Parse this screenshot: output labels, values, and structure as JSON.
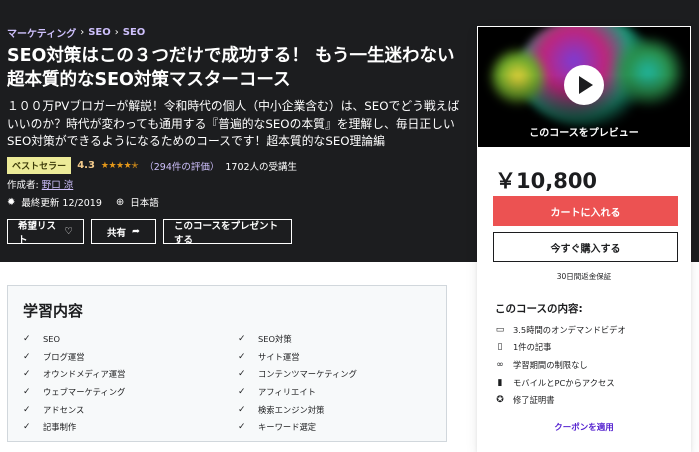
{
  "breadcrumb": {
    "items": [
      "マーケティング",
      "SEO",
      "SEO"
    ],
    "separator": "›"
  },
  "course": {
    "title": "SEO対策はこの３つだけで成功する！ もう一生迷わない超本質的なSEO対策マスターコース",
    "subtitle": "１００万PVブロガーが解説！令和時代の個人（中小企業含む）は、SEOでどう戦えばいいのか？時代が変わっても通用する『普遍的なSEOの本質』を理解し、毎日正しいSEO対策ができるようになるためのコースです！超本質的なSEO理論編",
    "badge": "ベストセラー",
    "rating": "4.3",
    "stars": "★★★★✭",
    "reviews": "（294件の評価）",
    "students": "1702人の受講生",
    "author_prefix": "作成者:",
    "author": "野口 涼",
    "last_updated": "最終更新 12/2019",
    "language": "日本語"
  },
  "actions": {
    "wishlist": "希望リスト",
    "share": "共有",
    "gift": "このコースをプレゼントする"
  },
  "sidebar": {
    "preview_label": "このコースをプレビュー",
    "price": "￥10,800",
    "cart_button": "カートに入れる",
    "buy_button": "今すぐ購入する",
    "guarantee": "30日間返金保証",
    "includes_title": "このコースの内容:",
    "includes": [
      {
        "icon": "video-icon",
        "glyph": "▭",
        "label": "3.5時間のオンデマンドビデオ"
      },
      {
        "icon": "file-icon",
        "glyph": "▯",
        "label": "1件の記事"
      },
      {
        "icon": "infinity-icon",
        "glyph": "∞",
        "label": "学習期間の制限なし"
      },
      {
        "icon": "mobile-icon",
        "glyph": "▮",
        "label": "モバイルとPCからアクセス"
      },
      {
        "icon": "certificate-icon",
        "glyph": "✪",
        "label": "修了証明書"
      }
    ],
    "coupon": "クーポンを適用"
  },
  "learn": {
    "title": "学習内容",
    "left": [
      "SEO",
      "ブログ運営",
      "オウンドメディア運営",
      "ウェブマーケティング",
      "アドセンス",
      "記事制作"
    ],
    "right": [
      "SEO対策",
      "サイト運営",
      "コンテンツマーケティング",
      "アフィリエイト",
      "検索エンジン対策",
      "キーワード選定"
    ]
  },
  "colors": {
    "hero_bg": "#1c1d1f",
    "link_purple": "#cec0fc",
    "badge_bg": "#eceb98",
    "star": "#e59819",
    "cart_red": "#ec5252",
    "coupon_purple": "#5624d0"
  }
}
